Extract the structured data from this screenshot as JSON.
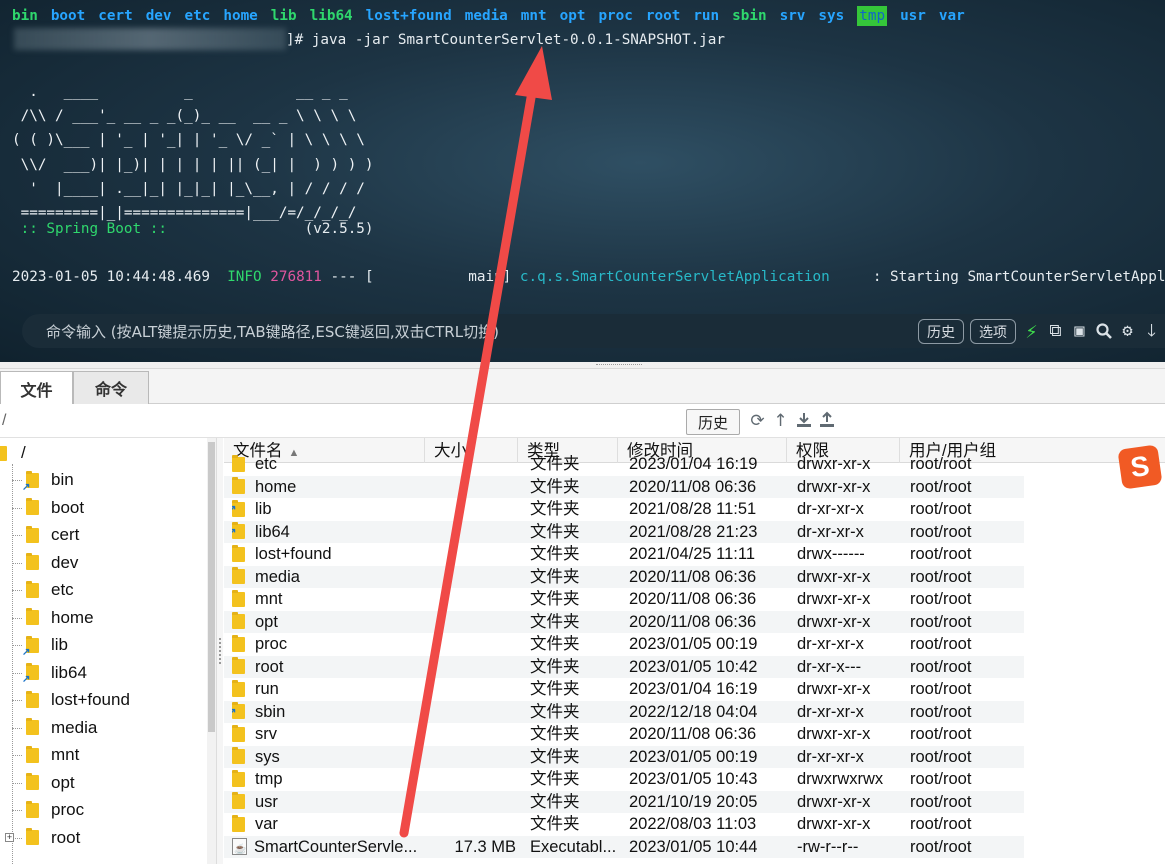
{
  "terminal": {
    "ls_entries": [
      {
        "name": "bin",
        "kind": "exec"
      },
      {
        "name": "boot",
        "kind": "dir"
      },
      {
        "name": "cert",
        "kind": "dir"
      },
      {
        "name": "dev",
        "kind": "dir"
      },
      {
        "name": "etc",
        "kind": "dir"
      },
      {
        "name": "home",
        "kind": "dir"
      },
      {
        "name": "lib",
        "kind": "exec"
      },
      {
        "name": "lib64",
        "kind": "exec"
      },
      {
        "name": "lost+found",
        "kind": "dir"
      },
      {
        "name": "media",
        "kind": "dir"
      },
      {
        "name": "mnt",
        "kind": "dir"
      },
      {
        "name": "opt",
        "kind": "dir"
      },
      {
        "name": "proc",
        "kind": "dir"
      },
      {
        "name": "root",
        "kind": "dir"
      },
      {
        "name": "run",
        "kind": "dir"
      },
      {
        "name": "sbin",
        "kind": "exec"
      },
      {
        "name": "srv",
        "kind": "dir"
      },
      {
        "name": "sys",
        "kind": "dir"
      },
      {
        "name": "tmp",
        "kind": "tmpdir"
      },
      {
        "name": "usr",
        "kind": "dir"
      },
      {
        "name": "var",
        "kind": "dir"
      }
    ],
    "prompt_command": "]# java -jar SmartCounterServlet-0.0.1-SNAPSHOT.jar",
    "banner": "  .   ____          _            __ _ _\n /\\\\ / ___'_ __ _ _(_)_ __  __ _ \\ \\ \\ \\\n( ( )\\___ | '_ | '_| | '_ \\/ _` | \\ \\ \\ \\\n \\\\/  ___)| |_)| | | | | || (_| |  ) ) ) )\n  '  |____| .__|_| |_|_| |_\\__, | / / / /\n =========|_|==============|___/=/_/_/_/",
    "spring_label": " :: Spring Boot :: ",
    "spring_version": "               (v2.5.5)",
    "log": {
      "timestamp": "2023-01-05 10:44:48.469",
      "level": "INFO",
      "pid": "276811",
      "sep": "--- [",
      "thread": "           main]",
      "logger": "c.q.s.SmartCounterServletApplication",
      "message": "     : Starting SmartCounterServletApplication"
    },
    "command_bar": {
      "placeholder": "命令输入 (按ALT键提示历史,TAB键路径,ESC键返回,双击CTRL切换)",
      "history_label": "历史",
      "options_label": "选项"
    }
  },
  "tabs": [
    {
      "label": "文件",
      "active": true
    },
    {
      "label": "命令",
      "active": false
    }
  ],
  "path_bar": {
    "path": "/",
    "history_label": "历史"
  },
  "tree": {
    "root": "/",
    "items": [
      "bin",
      "boot",
      "cert",
      "dev",
      "etc",
      "home",
      "lib",
      "lib64",
      "lost+found",
      "media",
      "mnt",
      "opt",
      "proc",
      "root"
    ],
    "links": [
      "bin",
      "lib",
      "lib64",
      "sbin"
    ]
  },
  "file_list": {
    "columns": {
      "name": "文件名",
      "size": "大小",
      "type": "类型",
      "mtime": "修改时间",
      "perm": "权限",
      "owner": "用户/用户组"
    },
    "rows": [
      {
        "name": "etc",
        "size": "",
        "type": "文件夹",
        "mtime": "2023/01/04 16:19",
        "perm": "drwxr-xr-x",
        "owner": "root/root",
        "icon": "folder"
      },
      {
        "name": "home",
        "size": "",
        "type": "文件夹",
        "mtime": "2020/11/08 06:36",
        "perm": "drwxr-xr-x",
        "owner": "root/root",
        "icon": "folder"
      },
      {
        "name": "lib",
        "size": "",
        "type": "文件夹",
        "mtime": "2021/08/28 11:51",
        "perm": "dr-xr-xr-x",
        "owner": "root/root",
        "icon": "link"
      },
      {
        "name": "lib64",
        "size": "",
        "type": "文件夹",
        "mtime": "2021/08/28 21:23",
        "perm": "dr-xr-xr-x",
        "owner": "root/root",
        "icon": "link"
      },
      {
        "name": "lost+found",
        "size": "",
        "type": "文件夹",
        "mtime": "2021/04/25 11:11",
        "perm": "drwx------",
        "owner": "root/root",
        "icon": "folder"
      },
      {
        "name": "media",
        "size": "",
        "type": "文件夹",
        "mtime": "2020/11/08 06:36",
        "perm": "drwxr-xr-x",
        "owner": "root/root",
        "icon": "folder"
      },
      {
        "name": "mnt",
        "size": "",
        "type": "文件夹",
        "mtime": "2020/11/08 06:36",
        "perm": "drwxr-xr-x",
        "owner": "root/root",
        "icon": "folder"
      },
      {
        "name": "opt",
        "size": "",
        "type": "文件夹",
        "mtime": "2020/11/08 06:36",
        "perm": "drwxr-xr-x",
        "owner": "root/root",
        "icon": "folder"
      },
      {
        "name": "proc",
        "size": "",
        "type": "文件夹",
        "mtime": "2023/01/05 00:19",
        "perm": "dr-xr-xr-x",
        "owner": "root/root",
        "icon": "folder"
      },
      {
        "name": "root",
        "size": "",
        "type": "文件夹",
        "mtime": "2023/01/05 10:42",
        "perm": "dr-xr-x---",
        "owner": "root/root",
        "icon": "folder"
      },
      {
        "name": "run",
        "size": "",
        "type": "文件夹",
        "mtime": "2023/01/04 16:19",
        "perm": "drwxr-xr-x",
        "owner": "root/root",
        "icon": "folder"
      },
      {
        "name": "sbin",
        "size": "",
        "type": "文件夹",
        "mtime": "2022/12/18 04:04",
        "perm": "dr-xr-xr-x",
        "owner": "root/root",
        "icon": "link"
      },
      {
        "name": "srv",
        "size": "",
        "type": "文件夹",
        "mtime": "2020/11/08 06:36",
        "perm": "drwxr-xr-x",
        "owner": "root/root",
        "icon": "folder"
      },
      {
        "name": "sys",
        "size": "",
        "type": "文件夹",
        "mtime": "2023/01/05 00:19",
        "perm": "dr-xr-xr-x",
        "owner": "root/root",
        "icon": "folder"
      },
      {
        "name": "tmp",
        "size": "",
        "type": "文件夹",
        "mtime": "2023/01/05 10:43",
        "perm": "drwxrwxrwx",
        "owner": "root/root",
        "icon": "folder"
      },
      {
        "name": "usr",
        "size": "",
        "type": "文件夹",
        "mtime": "2021/10/19 20:05",
        "perm": "drwxr-xr-x",
        "owner": "root/root",
        "icon": "folder"
      },
      {
        "name": "var",
        "size": "",
        "type": "文件夹",
        "mtime": "2022/08/03 11:03",
        "perm": "drwxr-xr-x",
        "owner": "root/root",
        "icon": "folder"
      },
      {
        "name": "SmartCounterServle...",
        "size": "17.3 MB",
        "type": "Executabl...",
        "mtime": "2023/01/05 10:44",
        "perm": "-rw-r--r--",
        "owner": "root/root",
        "icon": "jar"
      }
    ]
  },
  "ime": {
    "label": "S"
  },
  "colors": {
    "annotation_arrow": "#f04a47",
    "folder": "#f3c21e",
    "terminal_dir": "#27a5ff",
    "terminal_exec": "#2fd86d"
  }
}
